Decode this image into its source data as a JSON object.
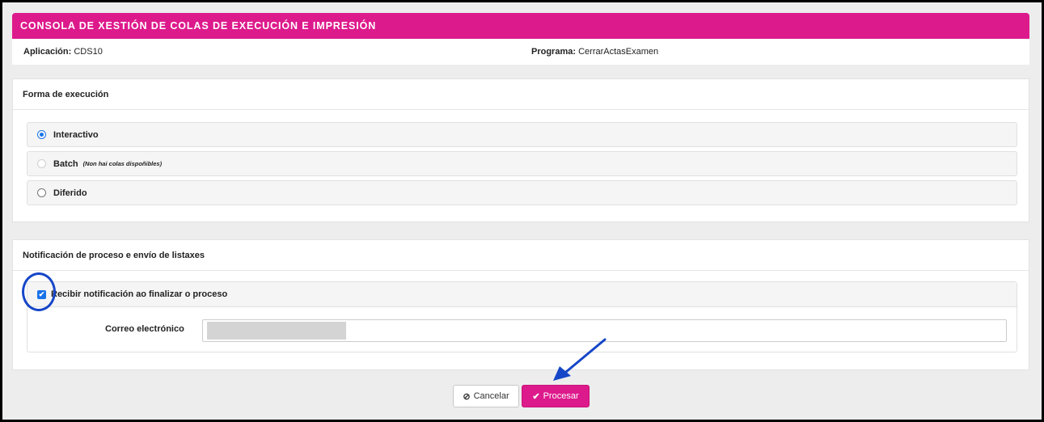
{
  "header": {
    "title": "CONSOLA DE XESTIÓN DE COLAS DE EXECUCIÓN E IMPRESIÓN"
  },
  "info": {
    "app_label": "Aplicación:",
    "app_value": "CDS10",
    "program_label": "Programa:",
    "program_value": "CerrarActasExamen"
  },
  "execution": {
    "heading": "Forma de execución",
    "options": [
      {
        "label": "Interactivo",
        "note": "",
        "state": "checked"
      },
      {
        "label": "Batch",
        "note": "(Non hai colas dispoñibles)",
        "state": "disabled"
      },
      {
        "label": "Diferido",
        "note": "",
        "state": "unchecked"
      }
    ]
  },
  "notification": {
    "heading": "Notificación de proceso e envío de listaxes",
    "checkbox_label": "Recibir notificación ao finalizar o proceso",
    "checkbox_checked": true,
    "email_label": "Correo electrónico",
    "email_value": ""
  },
  "actions": {
    "cancel_icon": "ban-icon",
    "cancel_label": "Cancelar",
    "process_icon": "check-icon",
    "process_label": "Procesar"
  },
  "colors": {
    "brand": "#dd1a8c",
    "accent": "#1a73e8",
    "annotation": "#1646c8"
  }
}
